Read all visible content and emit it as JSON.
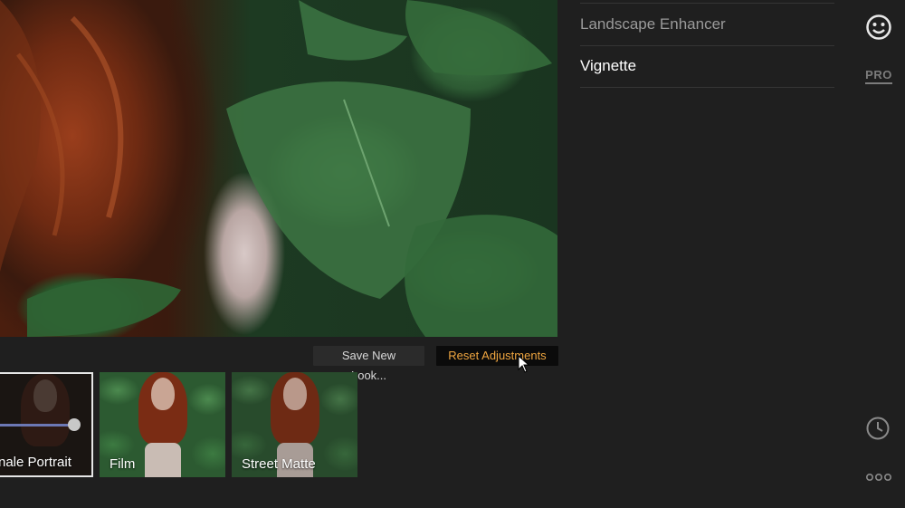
{
  "window": {
    "title": ""
  },
  "actions": {
    "save_label": "Save New Look...",
    "reset_label": "Reset Adjustments"
  },
  "looks": [
    {
      "label": "nale Portrait",
      "selected": true,
      "strength": 0.95
    },
    {
      "label": "Film",
      "selected": false
    },
    {
      "label": "Street Matte",
      "selected": false
    }
  ],
  "panel": {
    "items": [
      {
        "label": "Landscape Enhancer",
        "active": false
      },
      {
        "label": "Vignette",
        "active": true
      }
    ]
  },
  "rail": {
    "icons": [
      "smiley-icon",
      "pro-badge",
      "clock-icon",
      "more-dots-icon"
    ],
    "pro_label": "PRO"
  },
  "colors": {
    "accent": "#f0a640",
    "slider": "#6c78b5",
    "background": "#1f1f1f"
  }
}
